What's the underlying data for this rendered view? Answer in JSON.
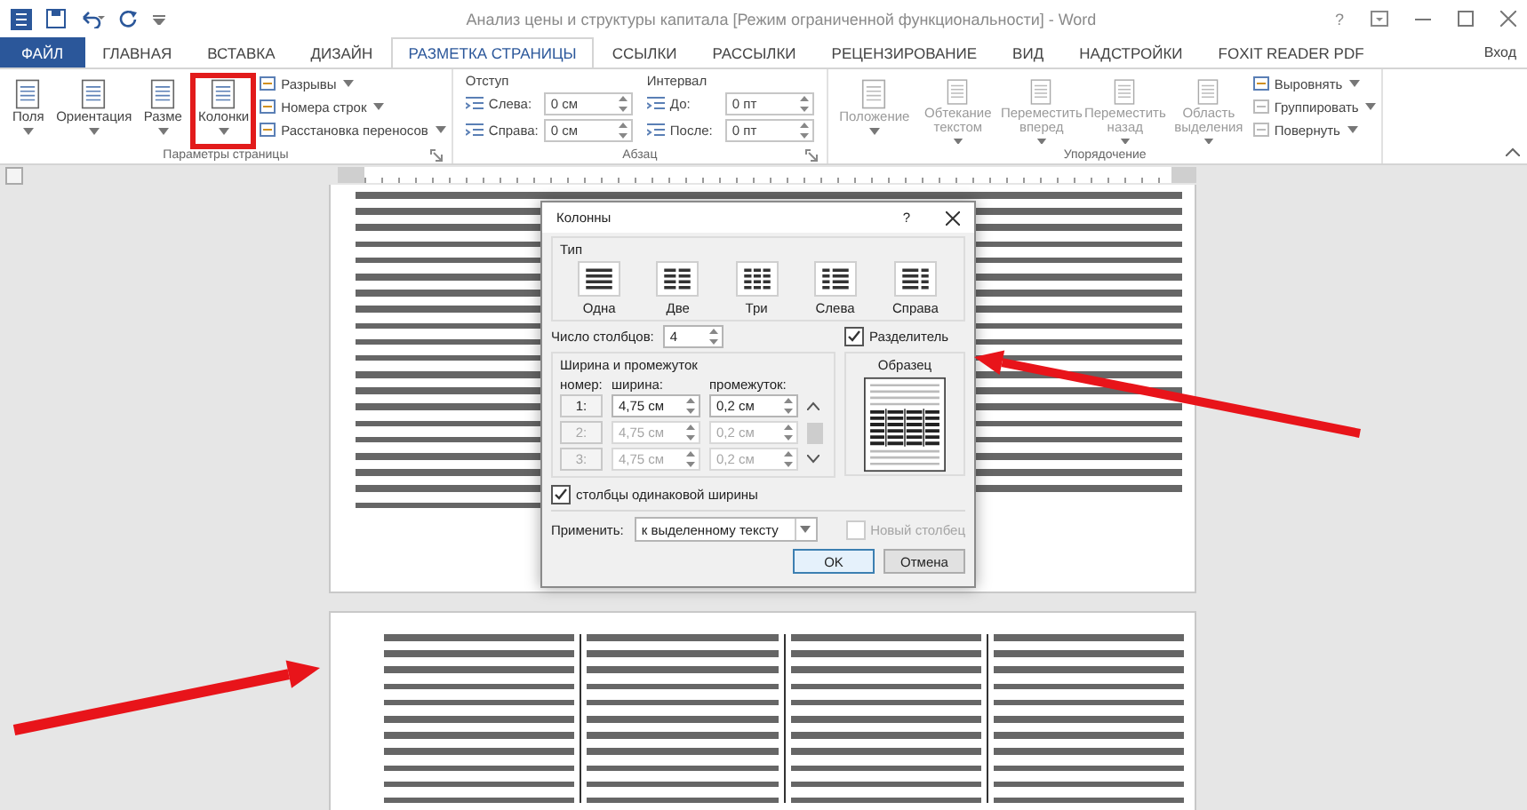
{
  "window": {
    "title": "Анализ цены и структуры капитала [Режим ограниченной функциональности] - Word",
    "help": "?"
  },
  "tabs": [
    {
      "label": "ФАЙЛ",
      "kind": "file",
      "selected": false
    },
    {
      "label": "ГЛАВНАЯ",
      "kind": "tab",
      "selected": false
    },
    {
      "label": "ВСТАВКА",
      "kind": "tab",
      "selected": false
    },
    {
      "label": "ДИЗАЙН",
      "kind": "tab",
      "selected": false
    },
    {
      "label": "РАЗМЕТКА СТРАНИЦЫ",
      "kind": "tab",
      "selected": true
    },
    {
      "label": "ССЫЛКИ",
      "kind": "tab",
      "selected": false
    },
    {
      "label": "РАССЫЛКИ",
      "kind": "tab",
      "selected": false
    },
    {
      "label": "РЕЦЕНЗИРОВАНИЕ",
      "kind": "tab",
      "selected": false
    },
    {
      "label": "ВИД",
      "kind": "tab",
      "selected": false
    },
    {
      "label": "НАДСТРОЙКИ",
      "kind": "tab",
      "selected": false
    },
    {
      "label": "FOXIT READER PDF",
      "kind": "tab",
      "selected": false
    }
  ],
  "account": "Вход",
  "page_setup": {
    "label": "Параметры страницы",
    "large_buttons": [
      {
        "label": "Поля",
        "highlighted": false
      },
      {
        "label": "Ориентация",
        "highlighted": false
      },
      {
        "label": "Разме",
        "highlighted": false
      },
      {
        "label": "Колонки",
        "highlighted": true
      }
    ],
    "small_buttons": [
      {
        "label": "Разрывы"
      },
      {
        "label": "Номера строк"
      },
      {
        "label": "Расстановка переносов"
      }
    ]
  },
  "paragraph": {
    "label": "Абзац",
    "indent": {
      "label": "Отступ",
      "fields": [
        {
          "label": "Слева:",
          "value": "0 см"
        },
        {
          "label": "Справа:",
          "value": "0 см"
        }
      ]
    },
    "spacing": {
      "label": "Интервал",
      "fields": [
        {
          "label": "До:",
          "value": "0 пт"
        },
        {
          "label": "После:",
          "value": "0 пт"
        }
      ]
    }
  },
  "arrange": {
    "label": "Упорядочение",
    "large_buttons": [
      {
        "label": "Положение",
        "disabled": true
      },
      {
        "label": "Обтекание текстом",
        "disabled": true
      },
      {
        "label": "Переместить вперед",
        "disabled": true
      },
      {
        "label": "Переместить назад",
        "disabled": true
      },
      {
        "label": "Область выделения",
        "disabled": true
      }
    ],
    "small_buttons": [
      {
        "label": "Выровнять",
        "disabled": false
      },
      {
        "label": "Группировать",
        "disabled": true
      },
      {
        "label": "Повернуть",
        "disabled": true
      }
    ]
  },
  "dialog": {
    "title": "Колонны",
    "help": "?",
    "type_label": "Тип",
    "presets": [
      {
        "label": "Одна",
        "kind": "one",
        "selected": false
      },
      {
        "label": "Две",
        "kind": "two",
        "selected": false
      },
      {
        "label": "Три",
        "kind": "three",
        "selected": false
      },
      {
        "label": "Слева",
        "kind": "left",
        "selected": false
      },
      {
        "label": "Справа",
        "kind": "right",
        "selected": false
      }
    ],
    "count": {
      "label": "Число столбцов:",
      "value": "4"
    },
    "separator": {
      "label": "Разделитель",
      "checked": true
    },
    "size_label": "Ширина и промежуток",
    "headers": [
      "номер:",
      "ширина:",
      "промежуток:"
    ],
    "rows": [
      {
        "number": "1:",
        "width": "4,75 см",
        "spacing": "0,2 см",
        "disabled": false
      },
      {
        "number": "2:",
        "width": "4,75 см",
        "spacing": "0,2 см",
        "disabled": true
      },
      {
        "number": "3:",
        "width": "4,75 см",
        "spacing": "0,2 см",
        "disabled": true
      }
    ],
    "equal_width": {
      "label": "столбцы одинаковой ширины",
      "checked": true
    },
    "preview_label": "Образец",
    "apply": {
      "label": "Применить:",
      "value": "к выделенному тексту"
    },
    "new_column": {
      "label": "Новый столбец",
      "checked": false,
      "disabled": true
    },
    "buttons": [
      {
        "label": "OK",
        "kind": "primary"
      },
      {
        "label": "Отмена",
        "kind": "normal"
      }
    ]
  }
}
